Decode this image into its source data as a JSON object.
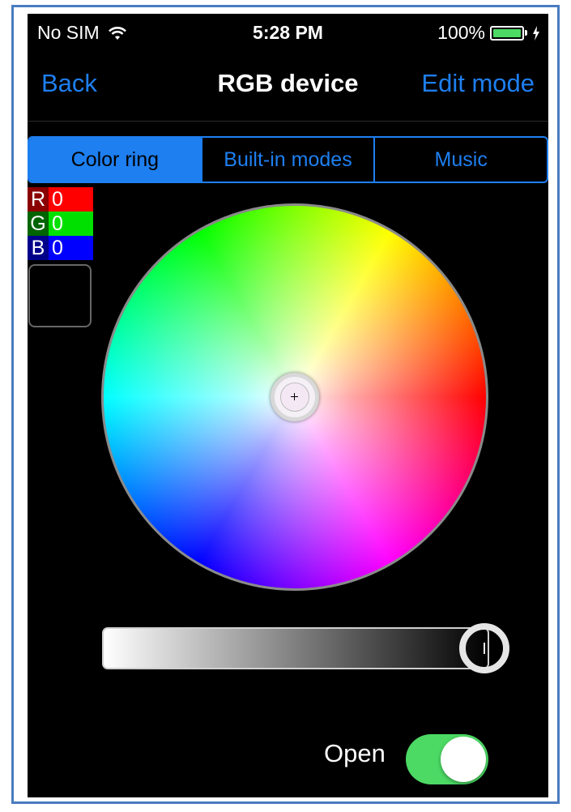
{
  "status_bar": {
    "carrier": "No SIM",
    "time": "5:28 PM",
    "battery": "100%"
  },
  "nav": {
    "back_label": "Back",
    "title": "RGB device",
    "edit_label": "Edit mode"
  },
  "tabs": [
    {
      "label": "Color ring",
      "active": true
    },
    {
      "label": "Built-in modes",
      "active": false
    },
    {
      "label": "Music",
      "active": false
    }
  ],
  "rgb": {
    "r": {
      "label": "R",
      "value": "0",
      "color": "#ff0000"
    },
    "g": {
      "label": "G",
      "value": "0",
      "color": "#00ff00"
    },
    "b": {
      "label": "B",
      "value": "0",
      "color": "#0000ff"
    }
  },
  "brightness": {
    "level": 1.0
  },
  "power": {
    "label": "Open",
    "on": true
  },
  "colors": {
    "accent": "#1e7ff0",
    "toggle_on": "#4cd964"
  }
}
